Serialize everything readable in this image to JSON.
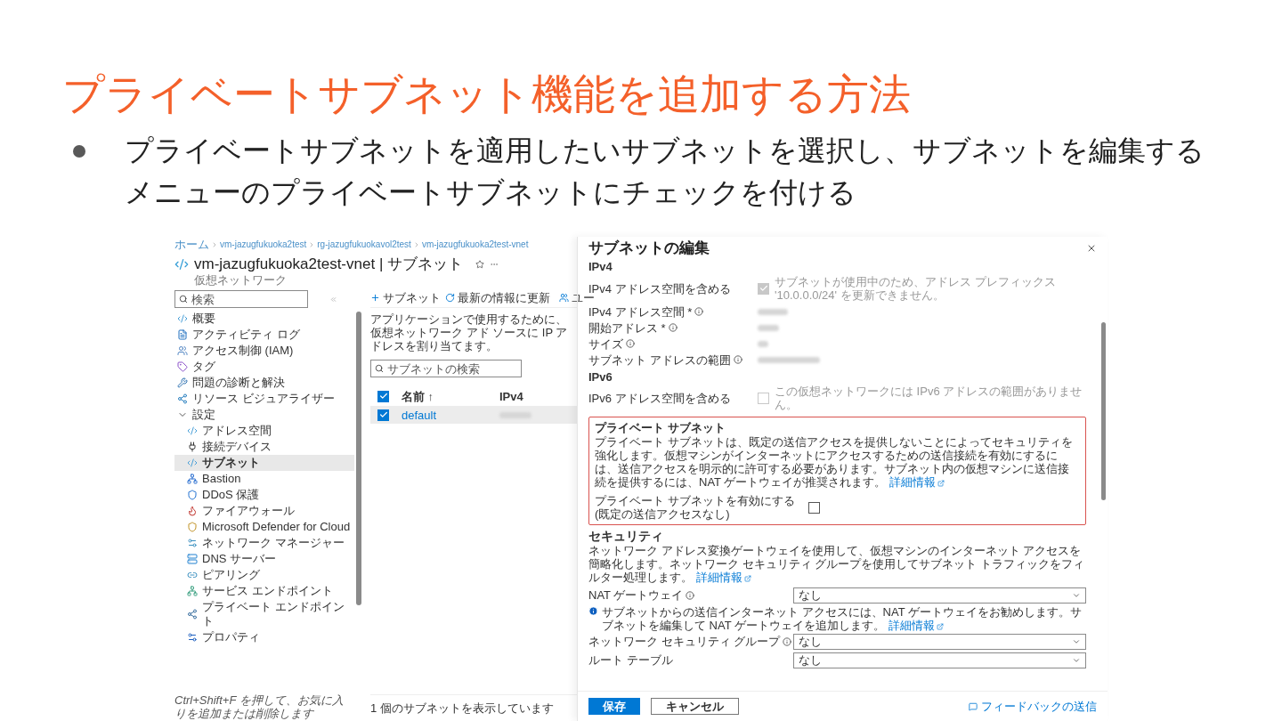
{
  "slide": {
    "title": "プライベートサブネット機能を追加する方法",
    "bullet": "プライベートサブネットを適用したいサブネットを選択し、サブネットを編集するメニューのプライベートサブネットにチェックを付ける"
  },
  "portal": {
    "breadcrumb": [
      "ホーム",
      "vm-jazugfukuoka2test",
      "rg-jazugfukuokavol2test",
      "vm-jazugfukuoka2test-vnet"
    ],
    "resource": {
      "title": "vm-jazugfukuoka2test-vnet | サブネット",
      "subtitle": "仮想ネットワーク"
    },
    "sidebar": {
      "search_placeholder": "検索",
      "items": [
        {
          "label": "概要",
          "selected": false
        },
        {
          "label": "アクティビティ ログ",
          "selected": false
        },
        {
          "label": "アクセス制御 (IAM)",
          "selected": false
        },
        {
          "label": "タグ",
          "selected": false
        },
        {
          "label": "問題の診断と解決",
          "selected": false
        },
        {
          "label": "リソース ビジュアライザー",
          "selected": false
        },
        {
          "label": "設定",
          "selected": false,
          "expanded": true,
          "children": [
            {
              "label": "アドレス空間",
              "selected": false
            },
            {
              "label": "接続デバイス",
              "selected": false
            },
            {
              "label": "サブネット",
              "selected": true
            },
            {
              "label": "Bastion",
              "selected": false
            },
            {
              "label": "DDoS 保護",
              "selected": false
            },
            {
              "label": "ファイアウォール",
              "selected": false
            },
            {
              "label": "Microsoft Defender for Cloud",
              "selected": false
            },
            {
              "label": "ネットワーク マネージャー",
              "selected": false
            },
            {
              "label": "DNS サーバー",
              "selected": false
            },
            {
              "label": "ピアリング",
              "selected": false
            },
            {
              "label": "サービス エンドポイント",
              "selected": false
            },
            {
              "label": "プライベート エンドポイント",
              "selected": false
            },
            {
              "label": "プロパティ",
              "selected": false
            }
          ]
        }
      ],
      "hint": "Ctrl+Shift+F を押して、お気に入りを追加または削除します"
    },
    "main": {
      "toolbar": [
        "サブネット",
        "最新の情報に更新",
        "ユー"
      ],
      "description": "アプリケーションで使用するために、仮想ネットワーク アド ソースに IP アドレスを割り当てます。",
      "search_placeholder": "サブネットの検索",
      "table": {
        "all_checked": true,
        "columns": [
          "名前 ↑",
          "IPv4"
        ],
        "rows": [
          {
            "name": "default",
            "checked": true,
            "selected": true
          }
        ]
      },
      "footer": "1 個のサブネットを表示しています"
    }
  },
  "panel": {
    "title": "サブネットの編集",
    "ipv4": {
      "heading": "IPv4",
      "include": {
        "label": "IPv4 アドレス空間を含める",
        "checked": true,
        "disabled": true,
        "note": "サブネットが使用中のため、アドレス プレフィックス '10.0.0.0/24' を更新できません。"
      },
      "fields": [
        {
          "label": "IPv4 アドレス空間 *",
          "info": true
        },
        {
          "label": "開始アドレス *",
          "info": true
        },
        {
          "label": "サイズ",
          "info": true
        },
        {
          "label": "サブネット アドレスの範囲",
          "info": true
        }
      ]
    },
    "ipv6": {
      "heading": "IPv6",
      "include": {
        "label": "IPv6 アドレス空間を含める",
        "checked": false,
        "disabled": true,
        "note": "この仮想ネットワークには IPv6 アドレスの範囲がありません。"
      }
    },
    "private_subnet": {
      "highlighted": true,
      "heading": "プライベート サブネット",
      "description": "プライベート サブネットは、既定の送信アクセスを提供しないことによってセキュリティを強化します。仮想マシンがインターネットにアクセスするための送信接続を有効にするには、送信アクセスを明示的に許可する必要があります。サブネット内の仮想マシンに送信接続を提供するには、NAT ゲートウェイが推奨されます。",
      "link": "詳細情報",
      "checkbox": {
        "label": "プライベート サブネットを有効にする (既定の送信アクセスなし)",
        "checked": false
      }
    },
    "security": {
      "heading": "セキュリティ",
      "description": "ネットワーク アドレス変換ゲートウェイを使用して、仮想マシンのインターネット アクセスを簡略化します。ネットワーク セキュリティ グループを使用してサブネット トラフィックをフィルター処理します。",
      "link": "詳細情報",
      "nat": {
        "label": "NAT ゲートウェイ",
        "info": true,
        "value": "なし"
      },
      "notice": {
        "text": "サブネットからの送信インターネット アクセスには、NAT ゲートウェイをお勧めします。サブネットを編集して NAT ゲートウェイを追加します。",
        "link": "詳細情報"
      },
      "selects": [
        {
          "label": "ネットワーク セキュリティ グループ",
          "info": true,
          "value": "なし"
        },
        {
          "label": "ルート テーブル",
          "info": false,
          "value": "なし"
        }
      ]
    },
    "buttons": [
      {
        "label": "保存",
        "kind": "primary"
      },
      {
        "label": "キャンセル",
        "kind": "secondary"
      }
    ],
    "feedback": "フィードバックの送信"
  }
}
